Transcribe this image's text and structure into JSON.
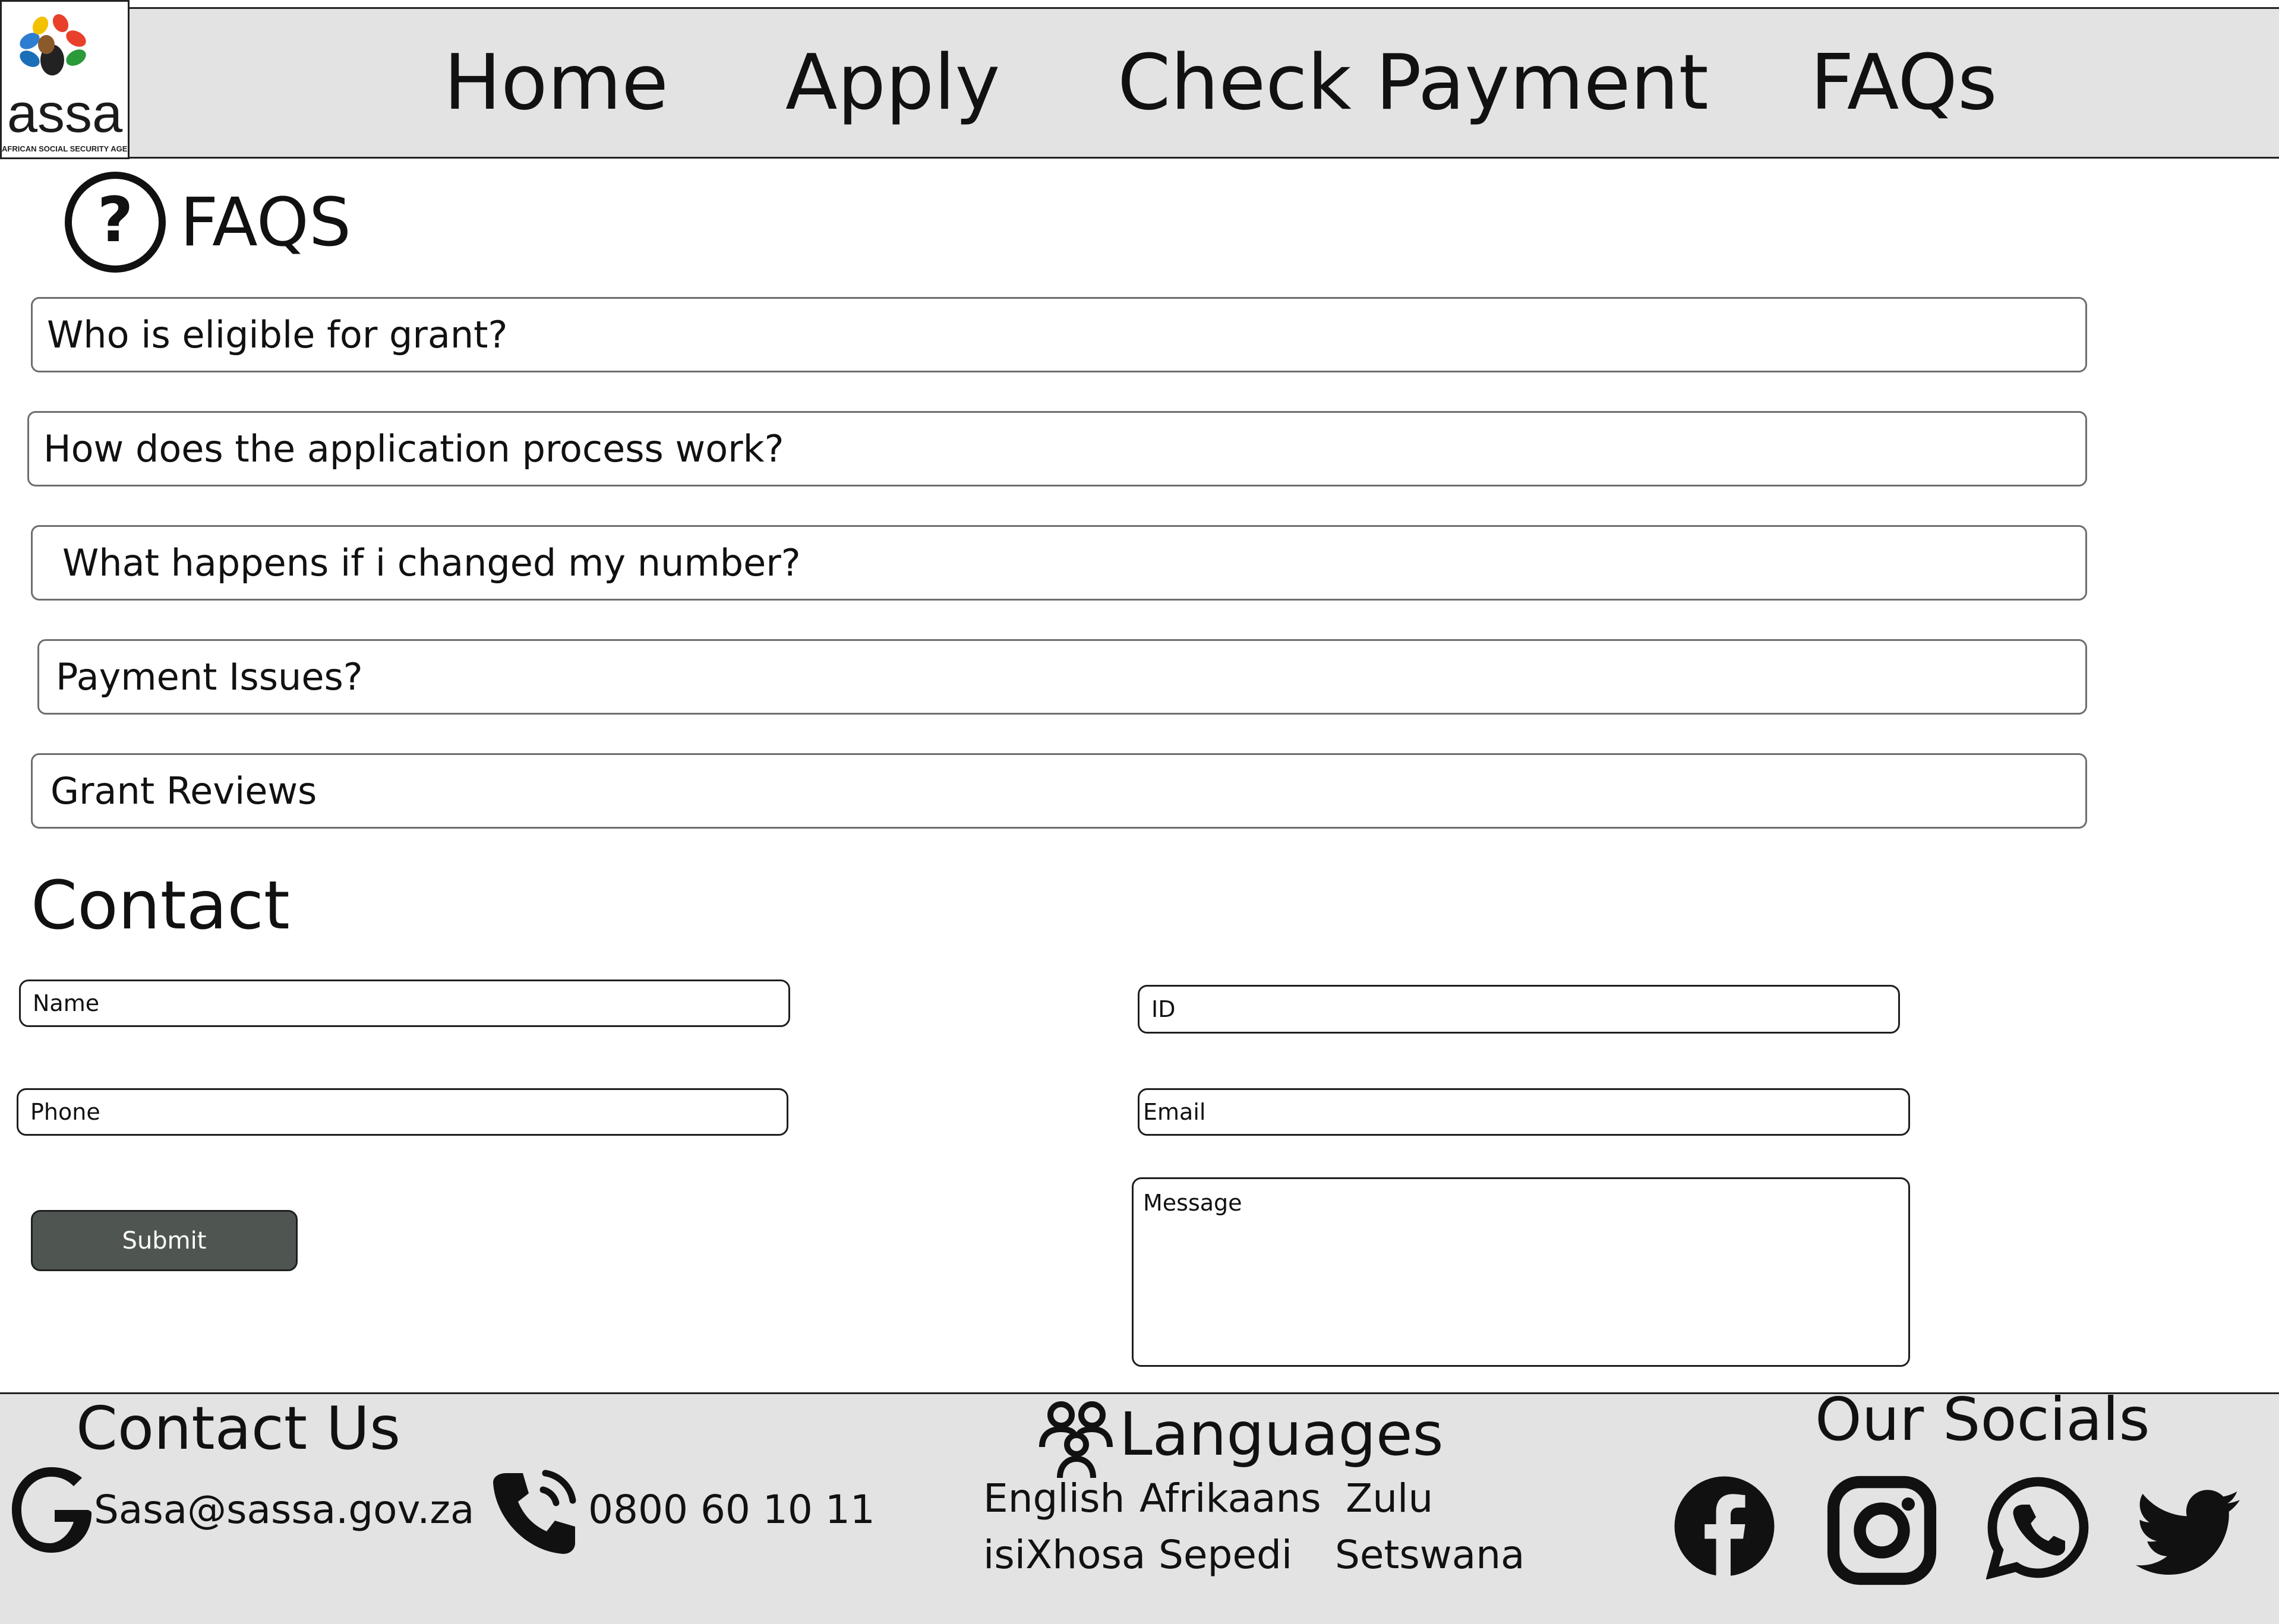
{
  "header": {
    "logo_text": "assa",
    "logo_subtext": "AFRICAN SOCIAL SECURITY AGENCY",
    "nav": {
      "home": "Home",
      "apply": "Apply",
      "check_payment": "Check Payment",
      "faqs": "FAQs"
    }
  },
  "faq": {
    "title": "FAQS",
    "items": [
      "Who is eligible for grant?",
      "How does the application process work?",
      "What happens if i changed my number?",
      "Payment Issues?",
      "Grant Reviews"
    ]
  },
  "contact": {
    "title": "Contact",
    "name_placeholder": "Name",
    "id_placeholder": "ID",
    "phone_placeholder": "Phone",
    "email_placeholder": "Email",
    "message_placeholder": "Message",
    "submit_label": "Submit"
  },
  "footer": {
    "contact_us": {
      "title": "Contact Us",
      "email": "Sasa@sassa.gov.za",
      "phone": "0800 60 10 11"
    },
    "languages": {
      "title": "Languages",
      "items": [
        "English",
        "Afrikaans",
        "Zulu",
        "isiXhosa",
        "Sepedi",
        "Setswana"
      ]
    },
    "socials": {
      "title": "Our Socials",
      "icons": [
        "facebook-icon",
        "instagram-icon",
        "whatsapp-icon",
        "twitter-icon"
      ]
    }
  },
  "colors": {
    "header_bg": "#e3e3e3",
    "footer_bg": "#e3e3e3",
    "submit_bg": "#4f5651",
    "faq_border": "#6e6e6e"
  }
}
